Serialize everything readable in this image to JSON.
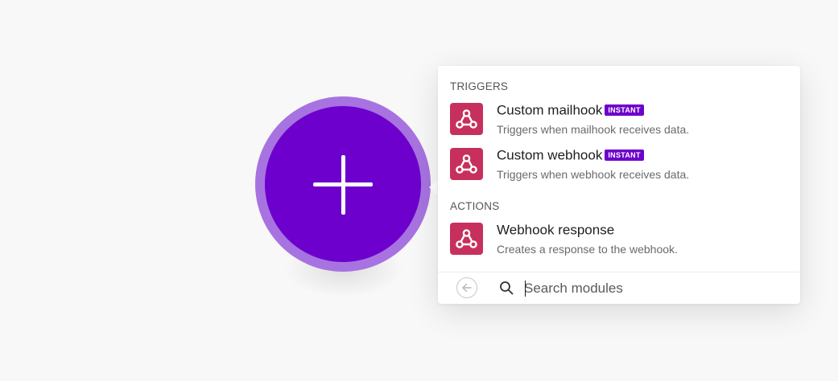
{
  "picker": {
    "triggers_heading": "TRIGGERS",
    "actions_heading": "ACTIONS",
    "triggers": [
      {
        "title": "Custom mailhook",
        "badge": "INSTANT",
        "description": "Triggers when mailhook receives data.",
        "icon": "webhooks-icon"
      },
      {
        "title": "Custom webhook",
        "badge": "INSTANT",
        "description": "Triggers when webhook receives data.",
        "icon": "webhooks-icon"
      }
    ],
    "actions": [
      {
        "title": "Webhook response",
        "description": "Creates a response to the webhook.",
        "icon": "webhooks-icon"
      }
    ],
    "search": {
      "placeholder": "Search modules",
      "value": ""
    }
  },
  "colors": {
    "accent": "#6d00cc",
    "accent_ring": "#a773e0",
    "module_icon_bg": "#c7305d",
    "canvas_bg": "#f8f8f8"
  }
}
